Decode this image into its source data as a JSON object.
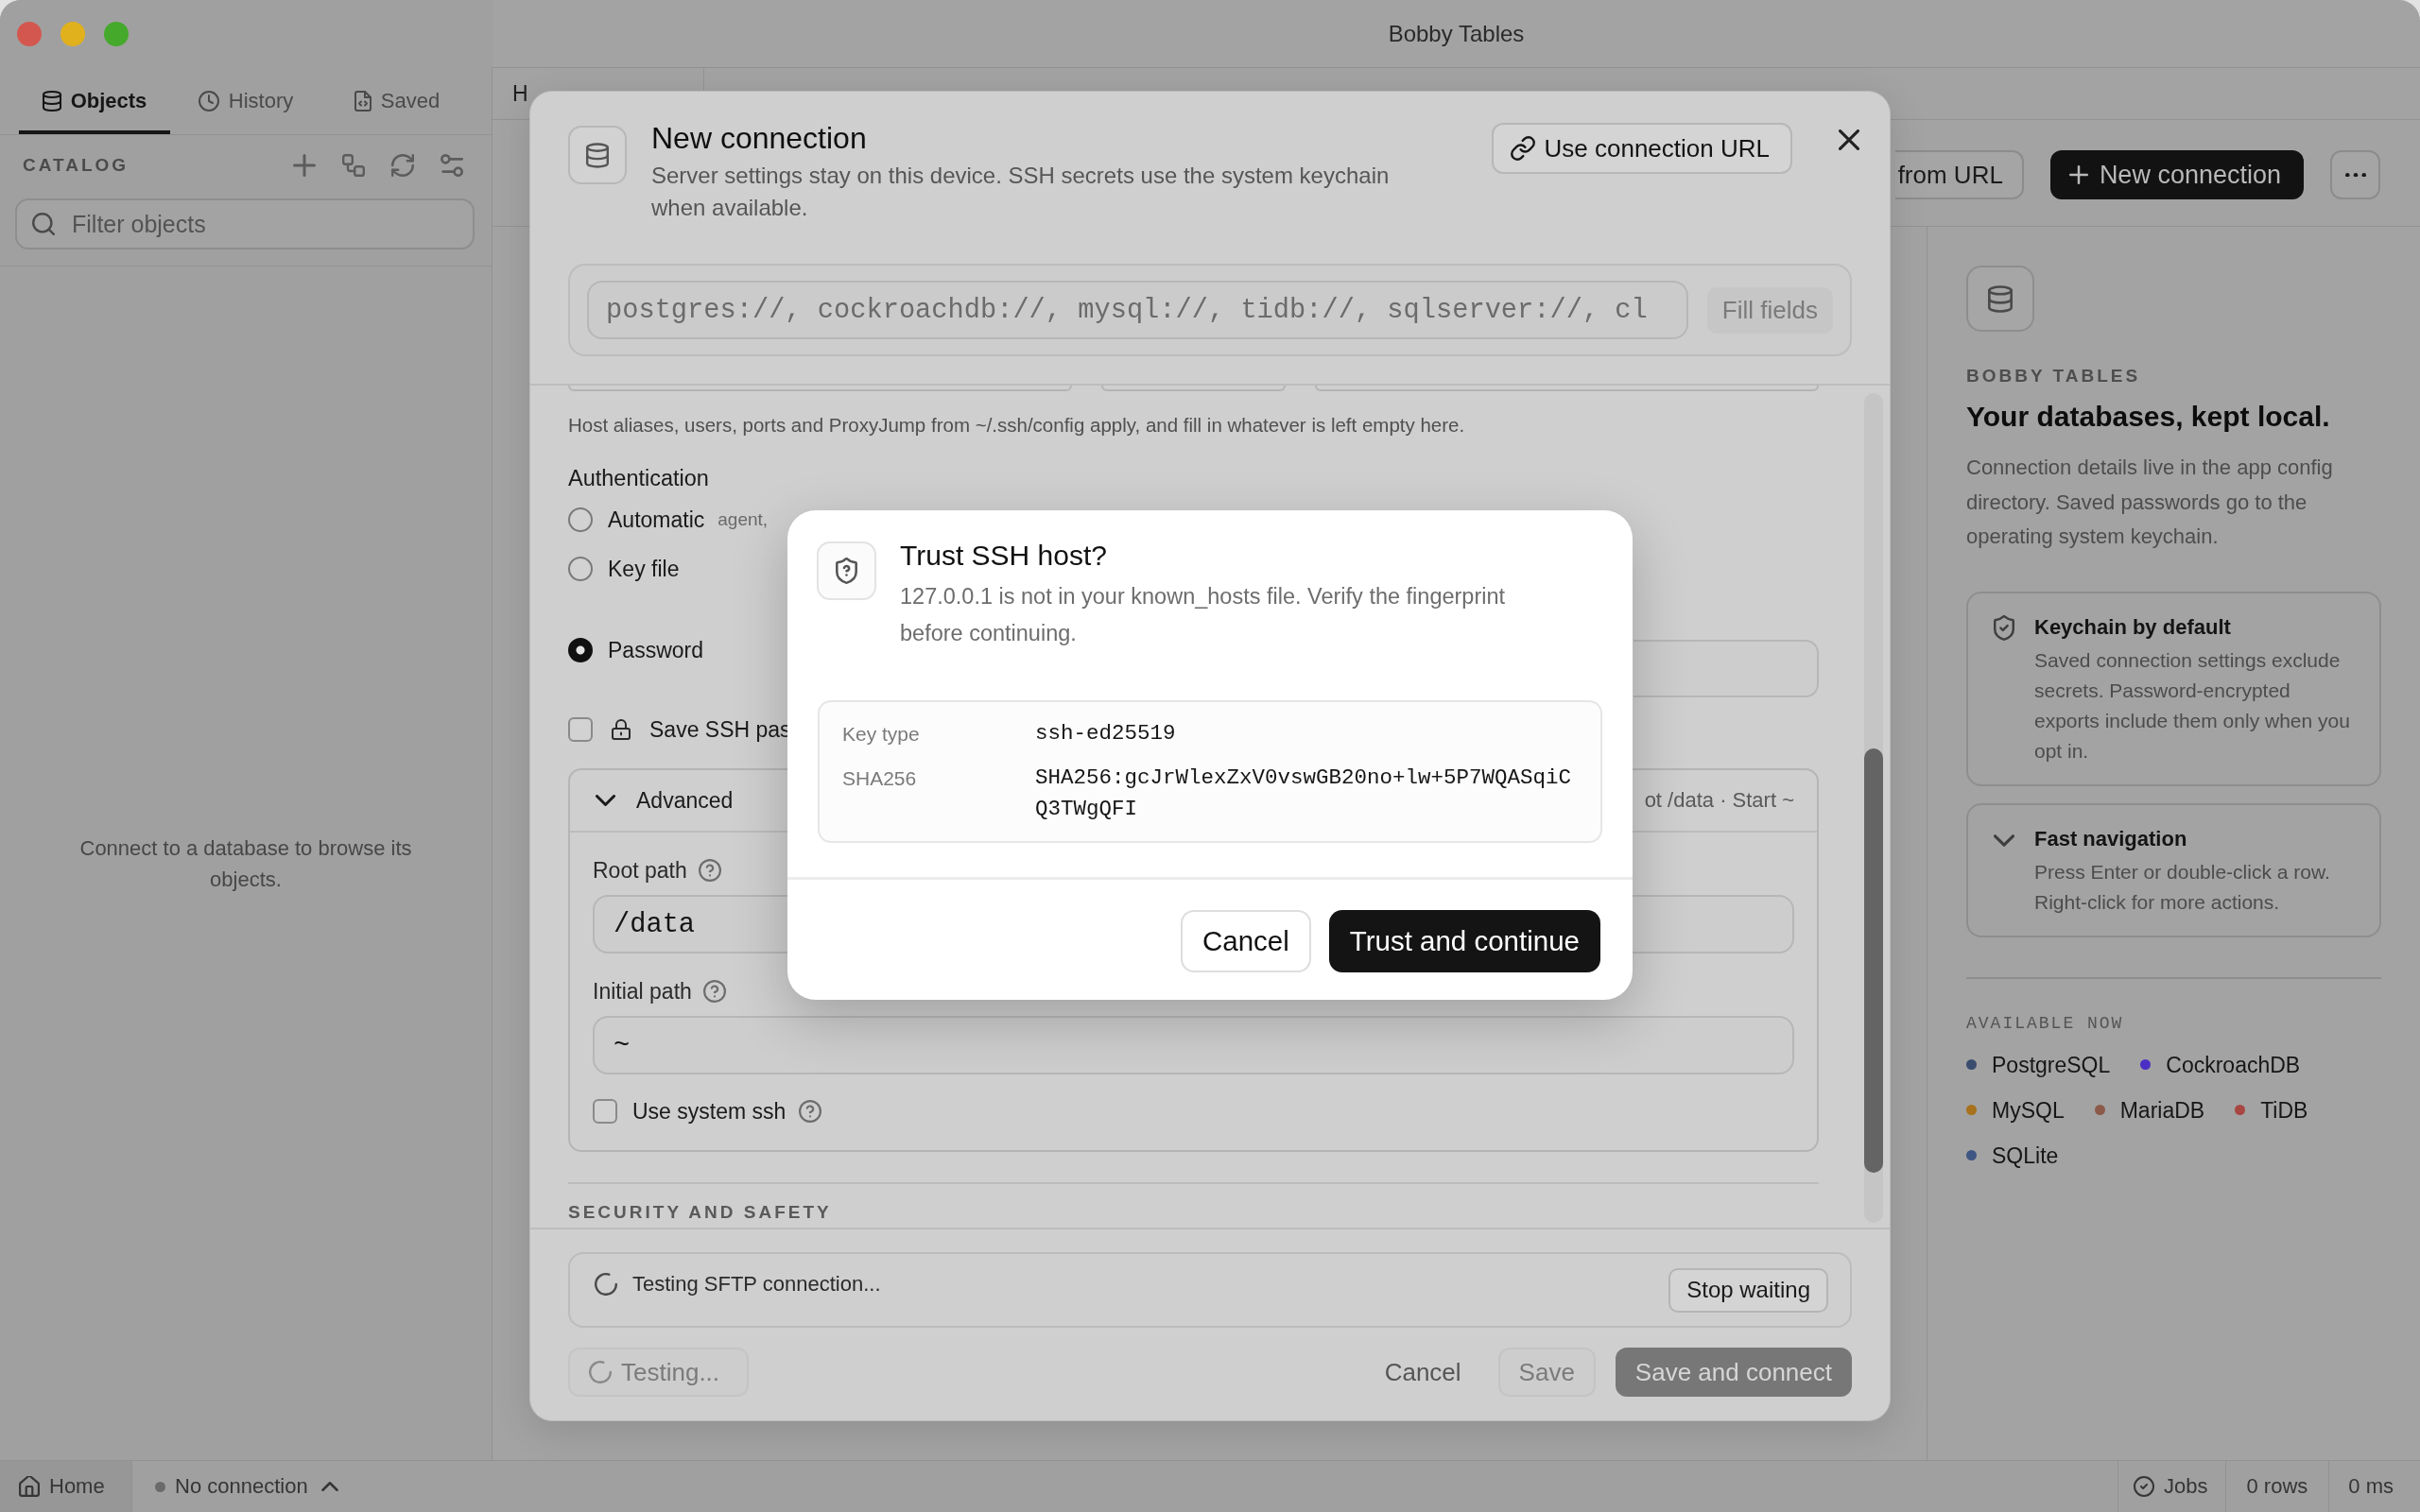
{
  "window": {
    "title": "Bobby Tables"
  },
  "sidebar": {
    "tabs": [
      {
        "label": "Objects",
        "selected": true
      },
      {
        "label": "History",
        "selected": false
      },
      {
        "label": "Saved",
        "selected": false
      }
    ],
    "catalog_label": "CATALOG",
    "filter": {
      "placeholder": "Filter objects"
    },
    "empty_message": "Connect to a database to browse its objects."
  },
  "main": {
    "tabs": [
      {
        "label": "H"
      }
    ],
    "toolbar": [
      {
        "kind": "outline",
        "label": "from URL"
      },
      {
        "kind": "primary",
        "label": "New connection"
      },
      {
        "kind": "more"
      }
    ]
  },
  "welcome": {
    "eyebrow": "BOBBY TABLES",
    "heading": "Your databases, kept local.",
    "text": "Connection details live in the app config directory. Saved passwords go to the operating system keychain.",
    "cards": [
      {
        "title": "Keychain by default",
        "text": "Saved connection settings exclude secrets. Password-encrypted exports include them only when you opt in."
      },
      {
        "title": "Fast navigation",
        "text": "Press Enter or double-click a row. Right-click for more actions."
      }
    ],
    "available_label": "AVAILABLE NOW",
    "engines": [
      {
        "name": "PostgreSQL",
        "color": "#3a4d6e"
      },
      {
        "name": "CockroachDB",
        "color": "#4b2fc4"
      },
      {
        "name": "MySQL",
        "color": "#a8711c"
      },
      {
        "name": "MariaDB",
        "color": "#8c5a48"
      },
      {
        "name": "TiDB",
        "color": "#a84642"
      },
      {
        "name": "SQLite",
        "color": "#3e5683"
      }
    ]
  },
  "connection_dialog": {
    "title": "New connection",
    "subtitle": "Server settings stay on this device. SSH secrets use the system keychain when available.",
    "url_button": "Use connection URL",
    "url_field": {
      "placeholder": "postgres://, cockroachdb://, mysql://, tidb://, sqlserver://, cl"
    },
    "fill_button": {
      "label": "Fill fields",
      "disabled": true
    },
    "ssh_hint": "Host aliases, users, ports and ProxyJump from ~/.ssh/config apply, and fill in whatever is left empty here.",
    "authentication": {
      "label": "Authentication",
      "options": [
        {
          "label": "Automatic",
          "hint": "agent,",
          "selected": false
        },
        {
          "label": "Key file",
          "selected": false
        },
        {
          "label": "Password",
          "selected": true
        }
      ]
    },
    "save_password": {
      "label": "Save SSH pas",
      "checked": false
    },
    "advanced": {
      "label": "Advanced",
      "expanded": true,
      "summary": "ot /data · Start ~",
      "fields": [
        {
          "label": "Root path",
          "value": "/data"
        },
        {
          "label": "Initial path",
          "value": "~"
        }
      ],
      "system_ssh": {
        "label": "Use system ssh",
        "checked": false
      }
    },
    "next_section": "SECURITY AND SAFETY",
    "progress": {
      "text": "Testing SFTP connection...",
      "button": "Stop waiting"
    },
    "actions": [
      {
        "kind": "progress",
        "label": "Testing...",
        "disabled": true
      },
      {
        "kind": "text",
        "label": "Cancel",
        "disabled": false
      },
      {
        "kind": "outline",
        "label": "Save",
        "disabled": true
      },
      {
        "kind": "primary",
        "label": "Save and connect",
        "disabled": true
      }
    ]
  },
  "trust_dialog": {
    "title": "Trust SSH host?",
    "text": "127.0.0.1 is not in your known_hosts file. Verify the fingerprint before continuing.",
    "details": [
      {
        "label": "Key type",
        "value": "ssh-ed25519"
      },
      {
        "label": "SHA256",
        "value": "SHA256:gcJrWlexZxV0vswGB20no+lw+5P7WQASqiCQ3TWgQFI"
      }
    ],
    "buttons": [
      {
        "kind": "outline",
        "label": "Cancel"
      },
      {
        "kind": "primary",
        "label": "Trust and continue"
      }
    ]
  },
  "status_bar": {
    "home": "Home",
    "connection": {
      "label": "No connection",
      "connected": false
    },
    "jobs": "Jobs",
    "rows": "0 rows",
    "duration": "0 ms"
  }
}
